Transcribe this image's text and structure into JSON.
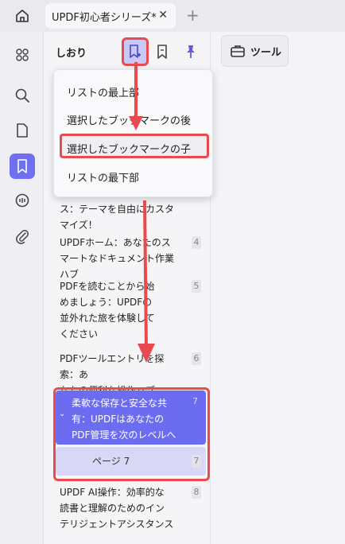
{
  "tab": {
    "title": "UPDF初心者シリーズ*",
    "close": "✕",
    "add": "+"
  },
  "panel": {
    "title": "しおり"
  },
  "tools": {
    "label": "ツール"
  },
  "dropdown": {
    "items": [
      "リストの最上部",
      "選択したブックマークの後",
      "選択したブックマークの子",
      "リストの最下部"
    ]
  },
  "bookmarks": [
    {
      "lines": [
        "ス：テーマを自由にカスタ",
        "マイズ！"
      ],
      "page": ""
    },
    {
      "lines": [
        "UPDFホーム：あなたのス",
        "マートなドキュメント作業ハブ"
      ],
      "page": "4"
    },
    {
      "lines": [
        "PDFを読むことから始",
        "めましょう：UPDFの",
        "並外れた旅を体験して",
        "ください"
      ],
      "page": "5"
    },
    {
      "lines": [
        "PDFツールエントリを探索：あ",
        "なたの便利な操作ハブ"
      ],
      "page": "6"
    },
    {
      "lines": [
        "UPDF AI操作：効率的な",
        "読書と理解のためのイン",
        "テリジェントアシスタンス"
      ],
      "page": "8"
    }
  ],
  "selected": {
    "lines": [
      "柔軟な保存と安全な共",
      "有：UPDFはあなたの",
      "PDF管理を次のレベルへ"
    ],
    "page": "7",
    "chevron": "⌄"
  },
  "child": {
    "label": "ページ 7",
    "page": "7"
  },
  "colors": {
    "accent": "#6c6cf0",
    "highlight_box": "#e84a4f",
    "arrow": "#e84a4f"
  }
}
